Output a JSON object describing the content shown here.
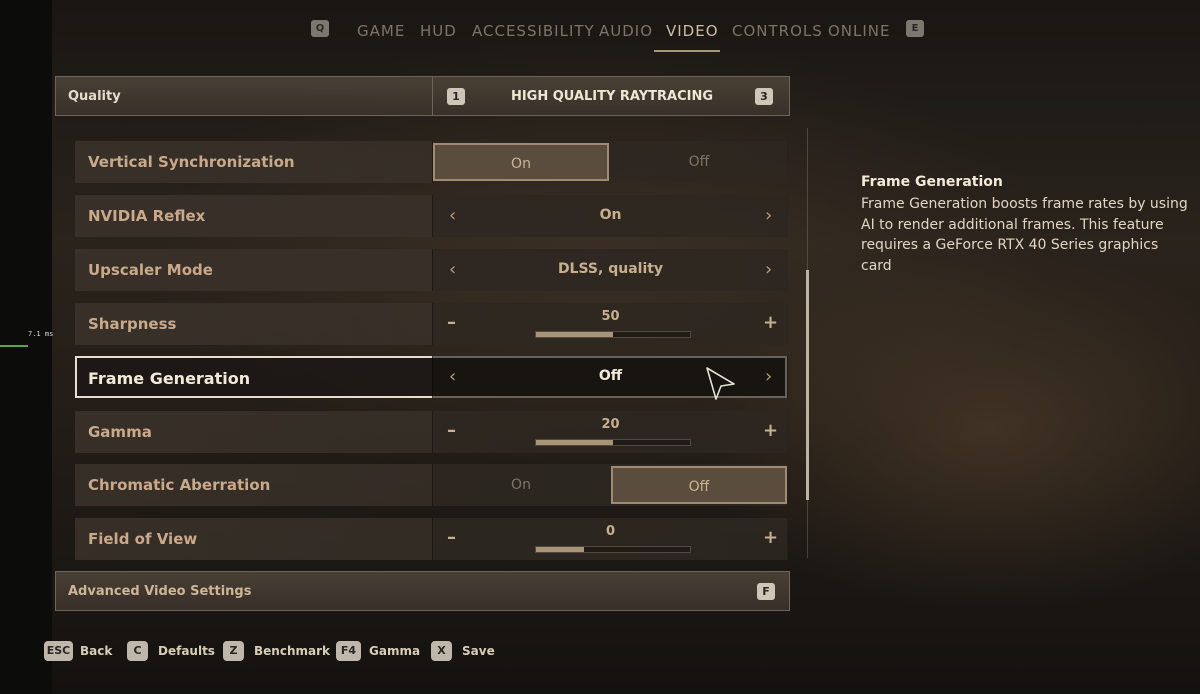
{
  "debug": {
    "frametime": "7.1 ms"
  },
  "tabs": {
    "prev_key": "Q",
    "next_key": "E",
    "items": [
      {
        "label": "GAME"
      },
      {
        "label": "HUD"
      },
      {
        "label": "ACCESSIBILITY"
      },
      {
        "label": "AUDIO"
      },
      {
        "label": "VIDEO",
        "active": true
      },
      {
        "label": "CONTROLS"
      },
      {
        "label": "ONLINE"
      }
    ]
  },
  "quality": {
    "label": "Quality",
    "value": "HIGH QUALITY RAYTRACING",
    "prev_key": "1",
    "next_key": "3"
  },
  "settings": [
    {
      "label": "Vertical Synchronization",
      "type": "toggle",
      "on": "On",
      "off": "Off",
      "selected": "On"
    },
    {
      "label": "NVIDIA Reflex",
      "type": "selector",
      "value": "On"
    },
    {
      "label": "Upscaler Mode",
      "type": "selector",
      "value": "DLSS, quality"
    },
    {
      "label": "Sharpness",
      "type": "slider",
      "value": "50",
      "fraction": 0.5
    },
    {
      "label": "Frame Generation",
      "type": "selector",
      "value": "Off",
      "focused": true
    },
    {
      "label": "Gamma",
      "type": "slider",
      "value": "20",
      "fraction": 0.5
    },
    {
      "label": "Chromatic Aberration",
      "type": "toggle",
      "on": "On",
      "off": "Off",
      "selected": "Off"
    },
    {
      "label": "Field of View",
      "type": "slider",
      "value": "0",
      "fraction": 0.31
    }
  ],
  "advanced": {
    "label": "Advanced Video Settings",
    "key": "F"
  },
  "info": {
    "title": "Frame Generation",
    "body": "Frame Generation boosts frame rates by using AI to render additional frames. This feature requires a GeForce RTX 40 Series graphics card"
  },
  "footer": [
    {
      "key": "ESC",
      "label": "Back"
    },
    {
      "key": "C",
      "label": "Defaults"
    },
    {
      "key": "Z",
      "label": "Benchmark"
    },
    {
      "key": "F4",
      "label": "Gamma"
    },
    {
      "key": "X",
      "label": "Save"
    }
  ],
  "glyphs": {
    "left": "‹",
    "right": "›",
    "minus": "–",
    "plus": "+"
  }
}
